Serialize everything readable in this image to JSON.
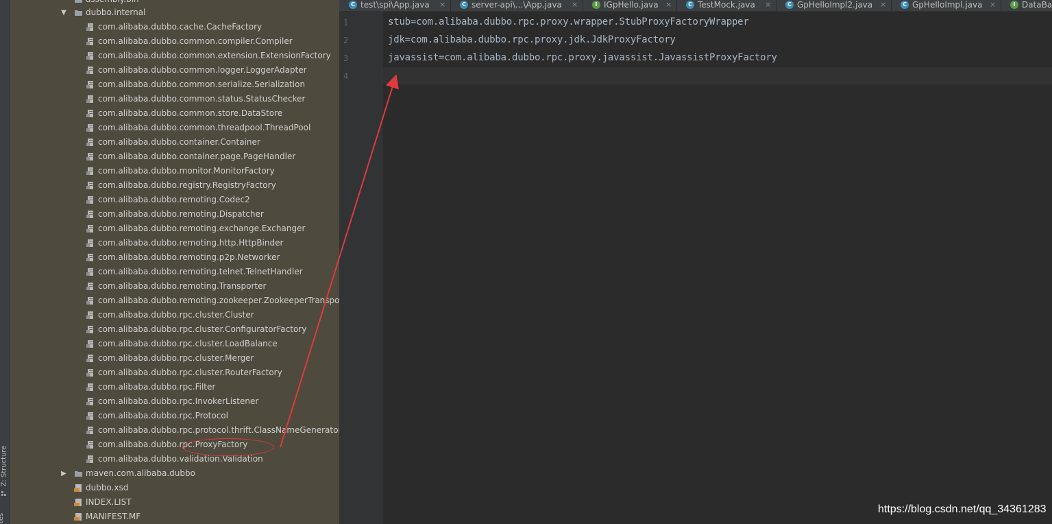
{
  "toolstrip": {
    "structure_label": "Z: Structure",
    "bottom_label": "tes"
  },
  "tree": {
    "top_partial": "assembly.bin",
    "folder_internal": "dubbo.internal",
    "items": [
      "com.alibaba.dubbo.cache.CacheFactory",
      "com.alibaba.dubbo.common.compiler.Compiler",
      "com.alibaba.dubbo.common.extension.ExtensionFactory",
      "com.alibaba.dubbo.common.logger.LoggerAdapter",
      "com.alibaba.dubbo.common.serialize.Serialization",
      "com.alibaba.dubbo.common.status.StatusChecker",
      "com.alibaba.dubbo.common.store.DataStore",
      "com.alibaba.dubbo.common.threadpool.ThreadPool",
      "com.alibaba.dubbo.container.Container",
      "com.alibaba.dubbo.container.page.PageHandler",
      "com.alibaba.dubbo.monitor.MonitorFactory",
      "com.alibaba.dubbo.registry.RegistryFactory",
      "com.alibaba.dubbo.remoting.Codec2",
      "com.alibaba.dubbo.remoting.Dispatcher",
      "com.alibaba.dubbo.remoting.exchange.Exchanger",
      "com.alibaba.dubbo.remoting.http.HttpBinder",
      "com.alibaba.dubbo.remoting.p2p.Networker",
      "com.alibaba.dubbo.remoting.telnet.TelnetHandler",
      "com.alibaba.dubbo.remoting.Transporter",
      "com.alibaba.dubbo.remoting.zookeeper.ZookeeperTranspo",
      "com.alibaba.dubbo.rpc.cluster.Cluster",
      "com.alibaba.dubbo.rpc.cluster.ConfiguratorFactory",
      "com.alibaba.dubbo.rpc.cluster.LoadBalance",
      "com.alibaba.dubbo.rpc.cluster.Merger",
      "com.alibaba.dubbo.rpc.cluster.RouterFactory",
      "com.alibaba.dubbo.rpc.Filter",
      "com.alibaba.dubbo.rpc.InvokerListener",
      "com.alibaba.dubbo.rpc.Protocol",
      "com.alibaba.dubbo.rpc.protocol.thrift.ClassNameGenerator",
      "com.alibaba.dubbo.rpc.ProxyFactory",
      "com.alibaba.dubbo.validation.Validation"
    ],
    "folder_maven": "maven.com.alibaba.dubbo",
    "files": [
      "dubbo.xsd",
      "INDEX.LIST",
      "MANIFEST.MF"
    ],
    "file_badges": [
      "XS",
      "",
      "MF"
    ]
  },
  "tabs": [
    {
      "label": "test\\spi\\App.java",
      "icon": "C",
      "color": "#3d8fb8"
    },
    {
      "label": "server-api\\...\\App.java",
      "icon": "C",
      "color": "#3d8fb8"
    },
    {
      "label": "IGpHello.java",
      "icon": "I",
      "color": "#5b9b4a"
    },
    {
      "label": "TestMock.java",
      "icon": "C",
      "color": "#3d8fb8"
    },
    {
      "label": "GpHelloImpl2.java",
      "icon": "C",
      "color": "#3d8fb8"
    },
    {
      "label": "GpHelloImpl.java",
      "icon": "C",
      "color": "#3d8fb8"
    },
    {
      "label": "DataBa",
      "icon": "I",
      "color": "#5b9b4a"
    }
  ],
  "editor": {
    "line_numbers": [
      "1",
      "2",
      "3",
      "4"
    ],
    "lines": [
      "stub=com.alibaba.dubbo.rpc.proxy.wrapper.StubProxyFactoryWrapper",
      "jdk=com.alibaba.dubbo.rpc.proxy.jdk.JdkProxyFactory",
      "javassist=com.alibaba.dubbo.rpc.proxy.javassist.JavassistProxyFactory",
      ""
    ]
  },
  "watermark": "https://blog.csdn.net/qq_34361283",
  "colors": {
    "annotation_red": "#e0393e",
    "panel_bg": "#4e4a3d",
    "editor_bg": "#2b2b2b"
  }
}
